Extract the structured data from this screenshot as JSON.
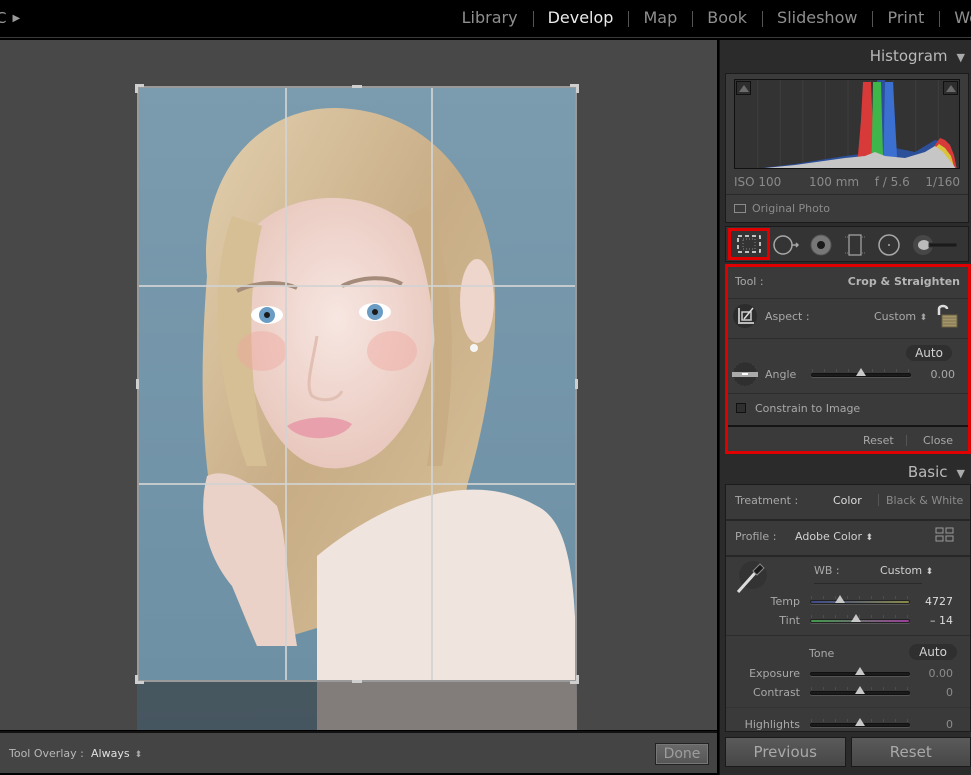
{
  "topbar": {
    "identity_plate": "C",
    "modules": [
      {
        "label": "Library",
        "active": false
      },
      {
        "label": "Develop",
        "active": true
      },
      {
        "label": "Map",
        "active": false
      },
      {
        "label": "Book",
        "active": false
      },
      {
        "label": "Slideshow",
        "active": false
      },
      {
        "label": "Print",
        "active": false
      },
      {
        "label": "We",
        "active": false
      }
    ]
  },
  "canvas": {
    "photo_description": "Portrait of a blonde young woman against a blue-grey background",
    "crop_overlay": "rule-of-thirds grid"
  },
  "toolbar": {
    "tool_overlay_label": "Tool Overlay :",
    "tool_overlay_value": "Always",
    "done_label": "Done"
  },
  "histogram": {
    "title": "Histogram",
    "iso": "ISO 100",
    "focal_length": "100 mm",
    "aperture": "f / 5.6",
    "shutter": "1/160",
    "original_photo_label": "Original Photo",
    "colors": {
      "red": "#d83a3a",
      "green": "#3fb64a",
      "blue": "#3b6fd0",
      "luma": "#c6c6c6"
    }
  },
  "tools": [
    {
      "name": "crop-overlay",
      "selected": true
    },
    {
      "name": "spot-removal",
      "selected": false
    },
    {
      "name": "red-eye",
      "selected": false
    },
    {
      "name": "graduated-filter",
      "selected": false
    },
    {
      "name": "radial-filter",
      "selected": false
    },
    {
      "name": "adjustment-brush",
      "selected": false
    }
  ],
  "crop_panel": {
    "tool_label": "Tool :",
    "tool_value": "Crop & Straighten",
    "aspect_label": "Aspect :",
    "aspect_value": "Custom",
    "aspect_locked": false,
    "auto_label": "Auto",
    "angle_label": "Angle",
    "angle_value": "0.00",
    "angle_slider_fraction": 0.5,
    "constrain_label": "Constrain to Image",
    "constrain_checked": false,
    "reset_label": "Reset",
    "close_label": "Close",
    "highlight_color": "#e00000"
  },
  "basic": {
    "title": "Basic",
    "treatment_label": "Treatment :",
    "treatment_color": "Color",
    "treatment_bw": "Black & White",
    "profile_label": "Profile :",
    "profile_value": "Adobe Color",
    "wb_label": "WB :",
    "wb_value": "Custom",
    "temp_label": "Temp",
    "temp_value": "4727",
    "temp_fraction": 0.3,
    "tint_label": "Tint",
    "tint_value": "– 14",
    "tint_fraction": 0.46,
    "tone_label": "Tone",
    "tone_auto_label": "Auto",
    "exposure_label": "Exposure",
    "exposure_value": "0.00",
    "exposure_fraction": 0.5,
    "contrast_label": "Contrast",
    "contrast_value": "0",
    "contrast_fraction": 0.5,
    "highlights_label": "Highlights",
    "highlights_value": "0",
    "highlights_fraction": 0.5
  },
  "footer_buttons": {
    "previous_label": "Previous",
    "reset_label": "Reset"
  }
}
